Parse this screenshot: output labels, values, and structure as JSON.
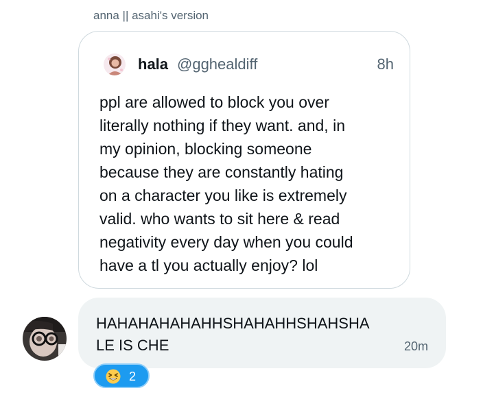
{
  "reply_context": {
    "sender_line": "anna || asahi's version"
  },
  "quoted_post": {
    "display_name": "hala",
    "handle": "@gghealdiff",
    "timestamp": "8h",
    "text": "ppl are allowed to block you over\nliterally nothing if they want. and, in\nmy opinion, blocking someone\nbecause they are constantly hating\non a character you like is extremely\nvalid. who wants to sit here & read\nnegativity every day when you could\nhave a tl you actually enjoy? lol"
  },
  "message": {
    "text": "HAHAHAHAHAHHSHAHAHHSHAHSHA\nLE IS CHE",
    "timestamp": "20m"
  },
  "reaction": {
    "emoji_icon": "grinning-squinting-face-icon",
    "count": "2",
    "color": "#1d9bf0"
  }
}
